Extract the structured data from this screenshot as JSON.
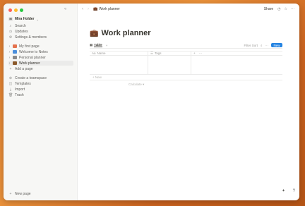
{
  "sidebar": {
    "workspace_initial": "M",
    "workspace_name": "Mira Holder",
    "nav_items": [
      {
        "label": "Search",
        "icon": "search-icon"
      },
      {
        "label": "Updates",
        "icon": "clock-icon"
      },
      {
        "label": "Settings & members",
        "icon": "gear-icon"
      }
    ],
    "pages": [
      {
        "label": "My first page",
        "icon_color": "#e4724d"
      },
      {
        "label": "Welcome to Notes",
        "icon_color": "#4b8fdc"
      },
      {
        "label": "Personal planner",
        "icon_color": "#8a8a8a"
      },
      {
        "label": "Work planner",
        "icon_color": "#8b5a2b"
      }
    ],
    "add_page": "Add a page",
    "secondary": [
      {
        "label": "Create a teamspace",
        "icon": "teamspace-icon"
      },
      {
        "label": "Templates",
        "icon": "templates-icon"
      },
      {
        "label": "Import",
        "icon": "import-icon"
      },
      {
        "label": "Trash",
        "icon": "trash-icon"
      }
    ],
    "new_page": "New page"
  },
  "topbar": {
    "breadcrumb": "Work planner",
    "share": "Share"
  },
  "page": {
    "emoji": "💼",
    "title": "Work planner",
    "view_tab": "Table",
    "toolbar_text": "Filter  Sort",
    "new_button": "New",
    "columns": [
      "Name",
      "Tags"
    ],
    "new_row": "+ New",
    "calculate": "Calculate ▾"
  },
  "colors": {
    "accent": "#2383e2",
    "sidebar_bg": "#f7f7f5",
    "text": "#37352f"
  }
}
